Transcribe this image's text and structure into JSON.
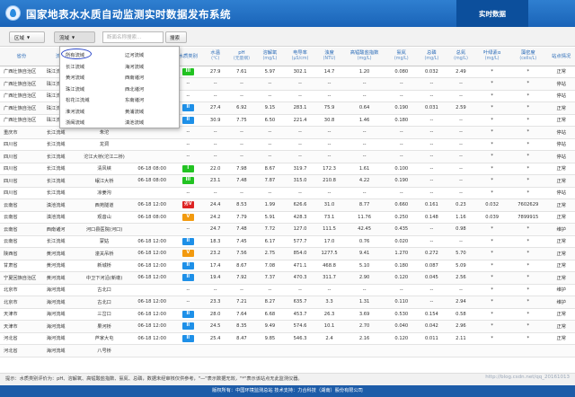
{
  "header": {
    "title": "国家地表水水质自动监测实时数据发布系统",
    "realtime_tab": "实时数据"
  },
  "toolbar": {
    "region_label": "区域",
    "basin_label": "流域",
    "search_placeholder": "断面名称搜索...",
    "search_label": "搜索"
  },
  "dropdown": {
    "options": [
      "所有流域",
      "辽河流域",
      "长江流域",
      "海河流域",
      "黄河流域",
      "西南诸河",
      "珠江流域",
      "西北诸河",
      "松花江流域",
      "东南诸河",
      "淮河流域",
      "黄浦流域",
      "浙闽流域",
      "滇池流域"
    ]
  },
  "table": {
    "columns": [
      {
        "label": "省份",
        "unit": ""
      },
      {
        "label": "流域",
        "unit": ""
      },
      {
        "label": "断面名称",
        "unit": ""
      },
      {
        "label": "监测时间",
        "unit": ""
      },
      {
        "label": "水质类别",
        "unit": ""
      },
      {
        "label": "水温",
        "unit": "(℃)"
      },
      {
        "label": "pH",
        "unit": "(无量纲)"
      },
      {
        "label": "溶解氧",
        "unit": "(mg/L)"
      },
      {
        "label": "电导率",
        "unit": "(μS/cm)"
      },
      {
        "label": "浊度",
        "unit": "(NTU)"
      },
      {
        "label": "高锰酸盐指数",
        "unit": "(mg/L)"
      },
      {
        "label": "氨氮",
        "unit": "(mg/L)"
      },
      {
        "label": "总磷",
        "unit": "(mg/L)"
      },
      {
        "label": "总氮",
        "unit": "(mg/L)"
      },
      {
        "label": "叶绿素α",
        "unit": "(mg/L)"
      },
      {
        "label": "藻密度",
        "unit": "(cells/L)"
      },
      {
        "label": "站点情况",
        "unit": ""
      }
    ],
    "rows": [
      {
        "cells": [
          "广西壮族自治区",
          "珠江流域",
          "",
          "",
          "III",
          "27.9",
          "7.61",
          "5.97",
          "302.1",
          "14.7",
          "1.20",
          "0.080",
          "0.032",
          "2.49",
          "*",
          "*",
          "正常"
        ],
        "wq_color": "#22c322"
      },
      {
        "cells": [
          "广西壮族自治区",
          "珠江流域",
          "",
          "",
          "--",
          "--",
          "--",
          "--",
          "--",
          "--",
          "--",
          "--",
          "--",
          "--",
          "*",
          "*",
          "停站"
        ],
        "wq_color": ""
      },
      {
        "cells": [
          "广西壮族自治区",
          "珠江流域",
          "",
          "",
          "--",
          "--",
          "--",
          "--",
          "--",
          "--",
          "--",
          "--",
          "--",
          "--",
          "*",
          "*",
          "停站"
        ],
        "wq_color": ""
      },
      {
        "cells": [
          "广西壮族自治区",
          "珠江流域",
          "",
          "",
          "II",
          "27.4",
          "6.92",
          "9.15",
          "283.1",
          "75.9",
          "0.64",
          "0.190",
          "0.031",
          "2.59",
          "*",
          "*",
          "正常"
        ],
        "wq_color": "#1e90e8"
      },
      {
        "cells": [
          "广西壮族自治区",
          "珠江流域",
          "",
          "",
          "II",
          "30.9",
          "7.75",
          "6.50",
          "221.4",
          "30.8",
          "1.46",
          "0.180",
          "--",
          "--",
          "*",
          "*",
          "正常"
        ],
        "wq_color": "#1e90e8"
      },
      {
        "cells": [
          "重庆市",
          "长江流域",
          "朱沱",
          "",
          "--",
          "--",
          "--",
          "--",
          "--",
          "--",
          "--",
          "--",
          "--",
          "--",
          "*",
          "*",
          "停站"
        ],
        "wq_color": ""
      },
      {
        "cells": [
          "四川省",
          "长江流域",
          "龙洞",
          "",
          "--",
          "--",
          "--",
          "--",
          "--",
          "--",
          "--",
          "--",
          "--",
          "--",
          "*",
          "*",
          "停站"
        ],
        "wq_color": ""
      },
      {
        "cells": [
          "四川省",
          "长江流域",
          "沱江大桥(沱江二桥)",
          "",
          "--",
          "--",
          "--",
          "--",
          "--",
          "--",
          "--",
          "--",
          "--",
          "--",
          "*",
          "*",
          "停站"
        ],
        "wq_color": ""
      },
      {
        "cells": [
          "四川省",
          "长江流域",
          "清风峡",
          "06-18 08:00",
          "I",
          "22.0",
          "7.98",
          "8.67",
          "319.7",
          "172.3",
          "1.61",
          "0.100",
          "--",
          "--",
          "*",
          "*",
          "正常"
        ],
        "wq_color": "#22c322"
      },
      {
        "cells": [
          "四川省",
          "长江流域",
          "岷江大桥",
          "06-18 08:00",
          "III",
          "23.1",
          "7.48",
          "7.87",
          "315.0",
          "210.8",
          "4.22",
          "0.190",
          "--",
          "--",
          "*",
          "*",
          "正常"
        ],
        "wq_color": "#22c322"
      },
      {
        "cells": [
          "四川省",
          "长江流域",
          "凉姜沟",
          "",
          "--",
          "--",
          "--",
          "--",
          "--",
          "--",
          "--",
          "--",
          "--",
          "--",
          "*",
          "*",
          "停站"
        ],
        "wq_color": ""
      },
      {
        "cells": [
          "云南省",
          "滇池流域",
          "西苑隧道",
          "06-18 12:00",
          "劣V",
          "24.4",
          "8.53",
          "1.99",
          "626.6",
          "31.0",
          "8.77",
          "0.660",
          "0.161",
          "0.23",
          "0.032",
          "7602629",
          "正常"
        ],
        "wq_color": "#dd2222"
      },
      {
        "cells": [
          "云南省",
          "滇池流域",
          "观音山",
          "06-18 08:00",
          "V",
          "24.2",
          "7.79",
          "5.91",
          "428.3",
          "73.1",
          "11.76",
          "0.250",
          "0.148",
          "1.16",
          "0.039",
          "7899915",
          "正常"
        ],
        "wq_color": "#f29a0f"
      },
      {
        "cells": [
          "云南省",
          "西南诸河",
          "河口县医院(河口)",
          "",
          "--",
          "24.7",
          "7.48",
          "7.72",
          "127.0",
          "111.5",
          "42.45",
          "0.435",
          "--",
          "0.98",
          "*",
          "*",
          "维护"
        ],
        "wq_color": ""
      },
      {
        "cells": [
          "云南省",
          "长江流域",
          "蒙姑",
          "06-18 12:00",
          "II",
          "18.3",
          "7.45",
          "6.17",
          "577.7",
          "17.0",
          "0.76",
          "0.020",
          "--",
          "--",
          "*",
          "*",
          "正常"
        ],
        "wq_color": "#1e90e8"
      },
      {
        "cells": [
          "陕西省",
          "黄河流域",
          "潼关吊桥",
          "06-18 12:00",
          "V",
          "23.2",
          "7.56",
          "2.75",
          "854.0",
          "1277.5",
          "9.41",
          "1.270",
          "0.272",
          "5.70",
          "*",
          "*",
          "正常"
        ],
        "wq_color": "#f29a0f"
      },
      {
        "cells": [
          "甘肃省",
          "黄河流域",
          "新城桥",
          "06-18 12:00",
          "II",
          "17.4",
          "8.67",
          "7.08",
          "471.1",
          "468.8",
          "5.10",
          "0.180",
          "0.087",
          "5.09",
          "*",
          "*",
          "正常"
        ],
        "wq_color": "#1e90e8"
      },
      {
        "cells": [
          "宁夏回族自治区",
          "黄河流域",
          "中卫下河沿(新墩)",
          "06-18 12:00",
          "II",
          "19.4",
          "7.92",
          "7.37",
          "470.3",
          "311.7",
          "2.90",
          "0.120",
          "0.045",
          "2.56",
          "*",
          "*",
          "正常"
        ],
        "wq_color": "#1e90e8"
      },
      {
        "cells": [
          "北京市",
          "海河流域",
          "古北口",
          "",
          "--",
          "--",
          "--",
          "--",
          "--",
          "--",
          "--",
          "--",
          "--",
          "--",
          "*",
          "*",
          "维护"
        ],
        "wq_color": ""
      },
      {
        "cells": [
          "北京市",
          "海河流域",
          "古北口",
          "06-18 12:00",
          "--",
          "23.3",
          "7.21",
          "8.27",
          "635.7",
          "3.3",
          "1.31",
          "0.110",
          "--",
          "2.94",
          "*",
          "*",
          "维护"
        ],
        "wq_color": ""
      },
      {
        "cells": [
          "天津市",
          "海河流域",
          "三岔口",
          "06-18 12:00",
          "II",
          "28.0",
          "7.64",
          "6.68",
          "453.7",
          "26.3",
          "3.69",
          "0.530",
          "0.154",
          "0.58",
          "*",
          "*",
          "正常"
        ],
        "wq_color": "#1e90e8"
      },
      {
        "cells": [
          "天津市",
          "海河流域",
          "果河桥",
          "06-18 12:00",
          "II",
          "24.5",
          "8.35",
          "9.49",
          "574.6",
          "10.1",
          "2.70",
          "0.040",
          "0.042",
          "2.96",
          "*",
          "*",
          "正常"
        ],
        "wq_color": "#1e90e8"
      },
      {
        "cells": [
          "河北省",
          "海河流域",
          "芦家大屯",
          "06-18 12:00",
          "II",
          "25.4",
          "8.47",
          "9.85",
          "546.3",
          "2.4",
          "2.16",
          "0.120",
          "0.011",
          "2.11",
          "*",
          "*",
          "正常"
        ],
        "wq_color": "#1e90e8"
      },
      {
        "cells": [
          "河北省",
          "海河流域",
          "八号桥",
          "",
          "",
          "",
          "",
          "",
          "",
          "",
          "",
          "",
          "",
          "",
          "",
          "",
          ""
        ],
        "wq_color": ""
      }
    ]
  },
  "hint": "提示：水质类别评价为：pH、溶解氧、高锰酸盐指数、氨氮、总磷，数据未经审核仅供参考，\"—\"表示数据无效，\"*\"表示该站点无此监测仪器。",
  "footer": "版权所有：中国环境监测总站   技术支持：力合科技（湖南）股份有限公司",
  "watermark": "http://blog.csdn.net/qq_20161013"
}
